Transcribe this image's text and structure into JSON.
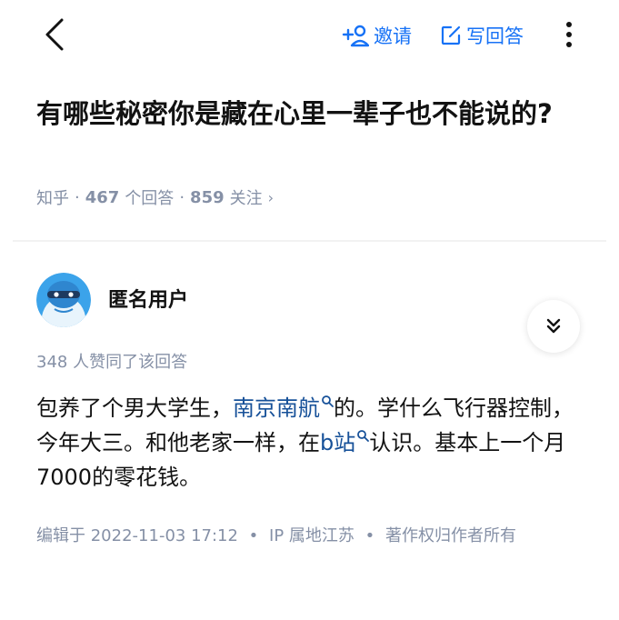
{
  "nav": {
    "invite_label": "邀请",
    "write_answer_label": "写回答"
  },
  "question": {
    "title": "有哪些秘密你是藏在心里一辈子也不能说的?",
    "source": "知乎",
    "answers_count": "467",
    "answers_suffix": "个回答",
    "follow_count": "859",
    "follow_suffix": "关注"
  },
  "answer": {
    "author": "匿名用户",
    "votes_text": "348 人赞同了该回答",
    "content": {
      "p1": "包养了个男大学生，",
      "link1": "南京南航",
      "p2": "的。学什么飞行器控制，今年大三。和他老家一样，在",
      "link2": "b站",
      "p3": "认识。基本上一个月7000的零花钱。"
    },
    "edited_label": "编辑于",
    "edited_time": "2022-11-03 17:12",
    "ip_location": "IP 属地江苏",
    "copyright": "著作权归作者所有"
  },
  "colors": {
    "accent": "#1772f6",
    "link": "#175199",
    "meta": "#8590a6",
    "text": "#121212"
  },
  "icons": [
    "back-arrow-icon",
    "add-person-icon",
    "edit-icon",
    "more-vertical-icon",
    "avatar-icon",
    "double-chevron-down-icon",
    "search-icon"
  ]
}
